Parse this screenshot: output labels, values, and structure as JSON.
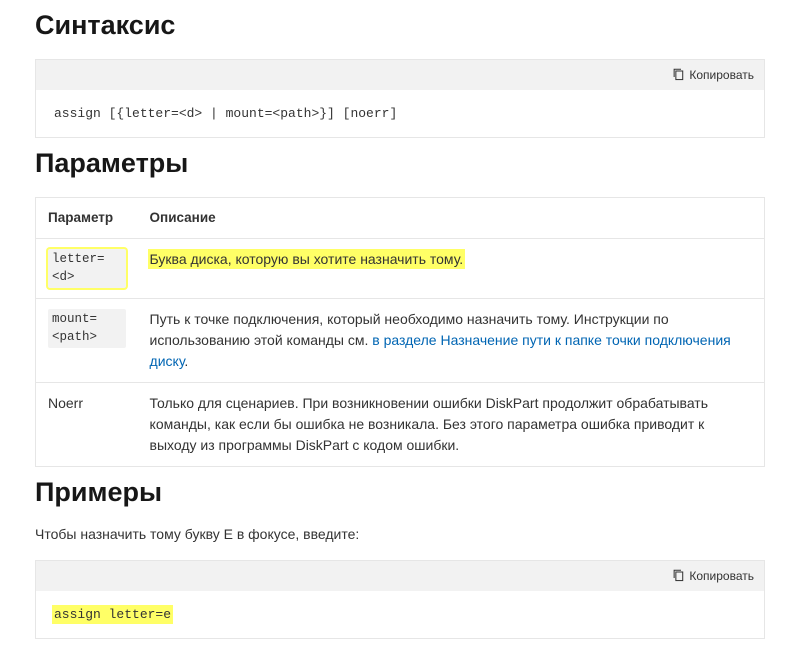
{
  "sections": {
    "syntax": {
      "heading": "Синтаксис",
      "copy_label": "Копировать",
      "code": "assign [{letter=<d> | mount=<path>}] [noerr]"
    },
    "parameters": {
      "heading": "Параметры",
      "columns": {
        "param": "Параметр",
        "desc": "Описание"
      },
      "rows": [
        {
          "param_code": "letter=<d>",
          "desc": "Буква диска, которую вы хотите назначить тому.",
          "highlighted": true
        },
        {
          "param_code": "mount=<path>",
          "desc_prefix": "Путь к точке подключения, который необходимо назначить тому. Инструкции по использованию этой команды см. ",
          "desc_link": "в разделе Назначение пути к папке точки подключения диску",
          "desc_suffix": "."
        },
        {
          "param_plain": "Noerr",
          "desc": "Только для сценариев. При возникновении ошибки DiskPart продолжит обрабатывать команды, как если бы ошибка не возникала. Без этого параметра ошибка приводит к выходу из программы DiskPart с кодом ошибки."
        }
      ]
    },
    "examples": {
      "heading": "Примеры",
      "intro": "Чтобы назначить тому букву E в фокусе, введите:",
      "copy_label": "Копировать",
      "code": "assign letter=e"
    }
  }
}
